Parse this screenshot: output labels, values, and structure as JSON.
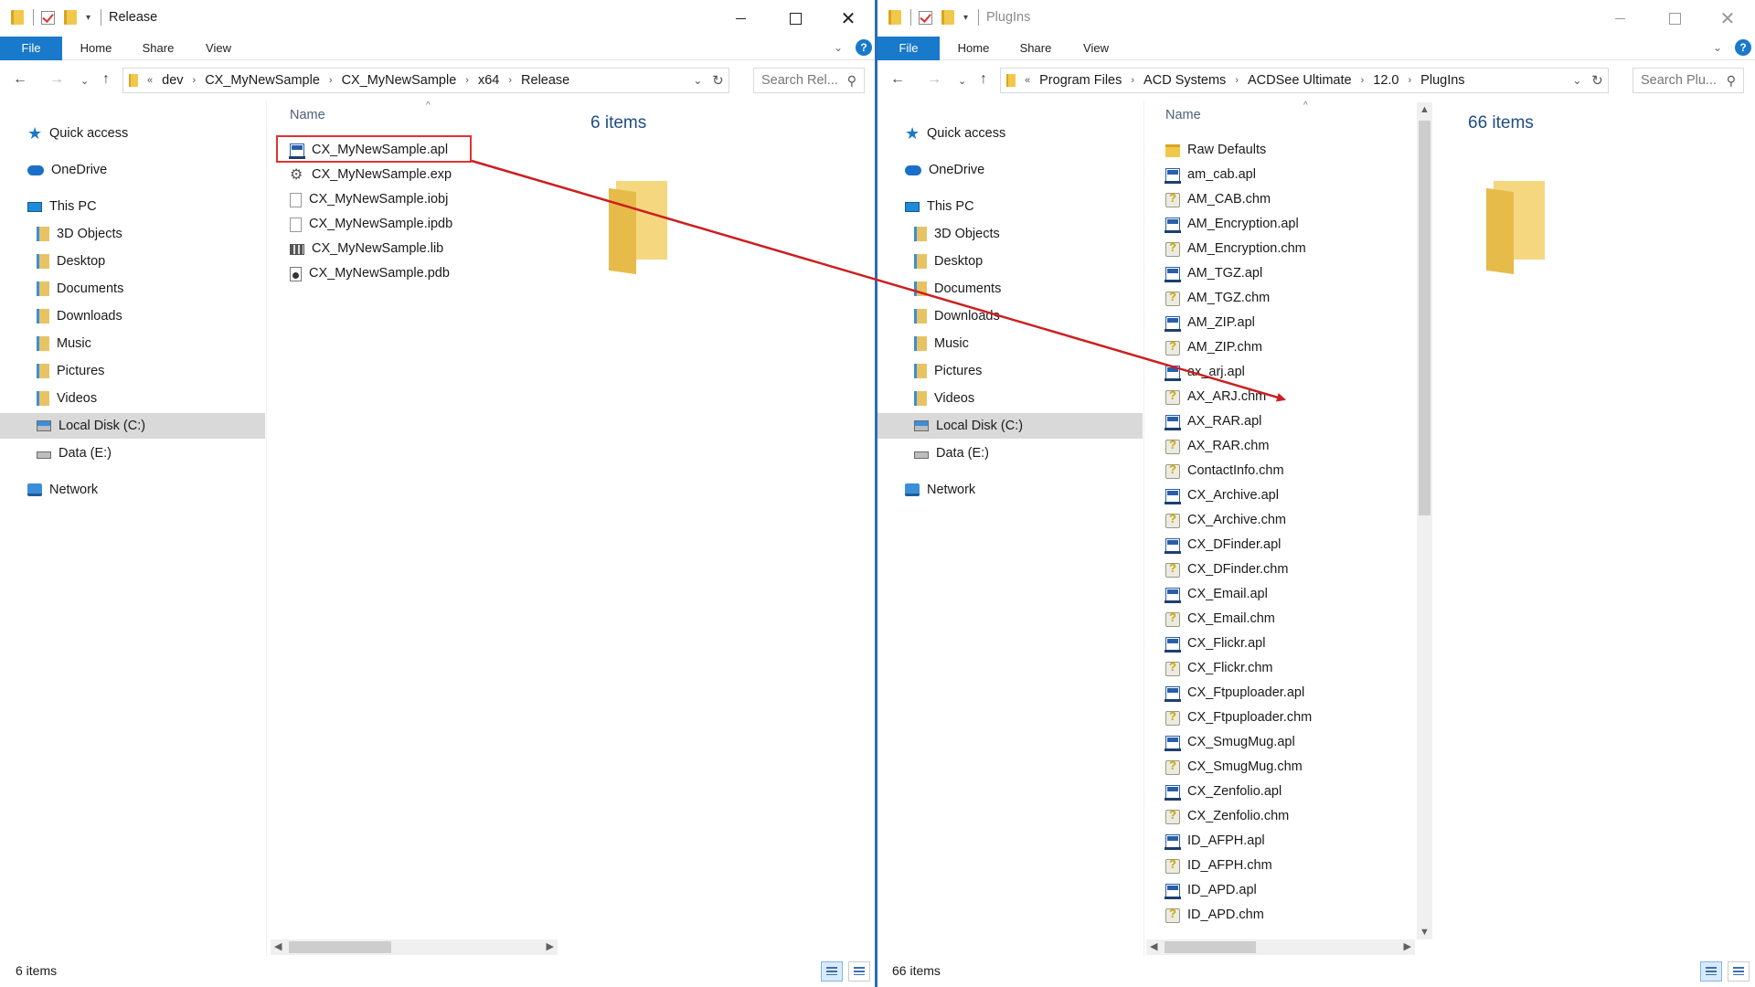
{
  "left": {
    "title": "Release",
    "ribbon_tabs": [
      "File",
      "Home",
      "Share",
      "View"
    ],
    "breadcrumb": [
      "dev",
      "CX_MyNewSample",
      "CX_MyNewSample",
      "x64",
      "Release"
    ],
    "search_placeholder": "Search Rel...",
    "column_name": "Name",
    "items_count": "6 items",
    "status": "6 items",
    "files": [
      {
        "name": "CX_MyNewSample.apl",
        "icon": "apl-icon"
      },
      {
        "name": "CX_MyNewSample.exp",
        "icon": "gear-file-icon"
      },
      {
        "name": "CX_MyNewSample.iobj",
        "icon": "blank-file-icon"
      },
      {
        "name": "CX_MyNewSample.ipdb",
        "icon": "blank-file-icon"
      },
      {
        "name": "CX_MyNewSample.lib",
        "icon": "lib-file-icon"
      },
      {
        "name": "CX_MyNewSample.pdb",
        "icon": "pdb-file-icon"
      }
    ]
  },
  "right": {
    "title": "PlugIns",
    "ribbon_tabs": [
      "File",
      "Home",
      "Share",
      "View"
    ],
    "breadcrumb": [
      "Program Files",
      "ACD Systems",
      "ACDSee Ultimate",
      "12.0",
      "PlugIns"
    ],
    "search_placeholder": "Search Plu...",
    "column_name": "Name",
    "items_count": "66 items",
    "status": "66 items",
    "files": [
      {
        "name": "Raw Defaults",
        "icon": "folder-icon"
      },
      {
        "name": "am_cab.apl",
        "icon": "apl-icon"
      },
      {
        "name": "AM_CAB.chm",
        "icon": "chm-icon"
      },
      {
        "name": "AM_Encryption.apl",
        "icon": "apl-icon"
      },
      {
        "name": "AM_Encryption.chm",
        "icon": "chm-icon"
      },
      {
        "name": "AM_TGZ.apl",
        "icon": "apl-icon"
      },
      {
        "name": "AM_TGZ.chm",
        "icon": "chm-icon"
      },
      {
        "name": "AM_ZIP.apl",
        "icon": "apl-icon"
      },
      {
        "name": "AM_ZIP.chm",
        "icon": "chm-icon"
      },
      {
        "name": "ax_arj.apl",
        "icon": "apl-icon"
      },
      {
        "name": "AX_ARJ.chm",
        "icon": "chm-icon"
      },
      {
        "name": "AX_RAR.apl",
        "icon": "apl-icon"
      },
      {
        "name": "AX_RAR.chm",
        "icon": "chm-icon"
      },
      {
        "name": "ContactInfo.chm",
        "icon": "chm-icon"
      },
      {
        "name": "CX_Archive.apl",
        "icon": "apl-icon"
      },
      {
        "name": "CX_Archive.chm",
        "icon": "chm-icon"
      },
      {
        "name": "CX_DFinder.apl",
        "icon": "apl-icon"
      },
      {
        "name": "CX_DFinder.chm",
        "icon": "chm-icon"
      },
      {
        "name": "CX_Email.apl",
        "icon": "apl-icon"
      },
      {
        "name": "CX_Email.chm",
        "icon": "chm-icon"
      },
      {
        "name": "CX_Flickr.apl",
        "icon": "apl-icon"
      },
      {
        "name": "CX_Flickr.chm",
        "icon": "chm-icon"
      },
      {
        "name": "CX_Ftpuploader.apl",
        "icon": "apl-icon"
      },
      {
        "name": "CX_Ftpuploader.chm",
        "icon": "chm-icon"
      },
      {
        "name": "CX_SmugMug.apl",
        "icon": "apl-icon"
      },
      {
        "name": "CX_SmugMug.chm",
        "icon": "chm-icon"
      },
      {
        "name": "CX_Zenfolio.apl",
        "icon": "apl-icon"
      },
      {
        "name": "CX_Zenfolio.chm",
        "icon": "chm-icon"
      },
      {
        "name": "ID_AFPH.apl",
        "icon": "apl-icon"
      },
      {
        "name": "ID_AFPH.chm",
        "icon": "chm-icon"
      },
      {
        "name": "ID_APD.apl",
        "icon": "apl-icon"
      },
      {
        "name": "ID_APD.chm",
        "icon": "chm-icon"
      }
    ]
  },
  "nav": [
    {
      "label": "Quick access",
      "icon": "star-icon",
      "indent": 0
    },
    {
      "label": "OneDrive",
      "icon": "cloud-icon",
      "indent": 0
    },
    {
      "label": "This PC",
      "icon": "pc-icon",
      "indent": 0
    },
    {
      "label": "3D Objects",
      "icon": "folder-icon",
      "indent": 1
    },
    {
      "label": "Desktop",
      "icon": "folder-icon",
      "indent": 1
    },
    {
      "label": "Documents",
      "icon": "folder-icon",
      "indent": 1
    },
    {
      "label": "Downloads",
      "icon": "folder-icon",
      "indent": 1
    },
    {
      "label": "Music",
      "icon": "folder-icon",
      "indent": 1
    },
    {
      "label": "Pictures",
      "icon": "folder-icon",
      "indent": 1
    },
    {
      "label": "Videos",
      "icon": "folder-icon",
      "indent": 1
    },
    {
      "label": "Local Disk (C:)",
      "icon": "drive-c-icon",
      "indent": 1,
      "selected": true
    },
    {
      "label": "Data (E:)",
      "icon": "drive-icon",
      "indent": 1
    },
    {
      "label": "Network",
      "icon": "network-icon",
      "indent": 0
    }
  ],
  "colors": {
    "accent": "#1979ca",
    "annotation": "#cc1f1f"
  }
}
